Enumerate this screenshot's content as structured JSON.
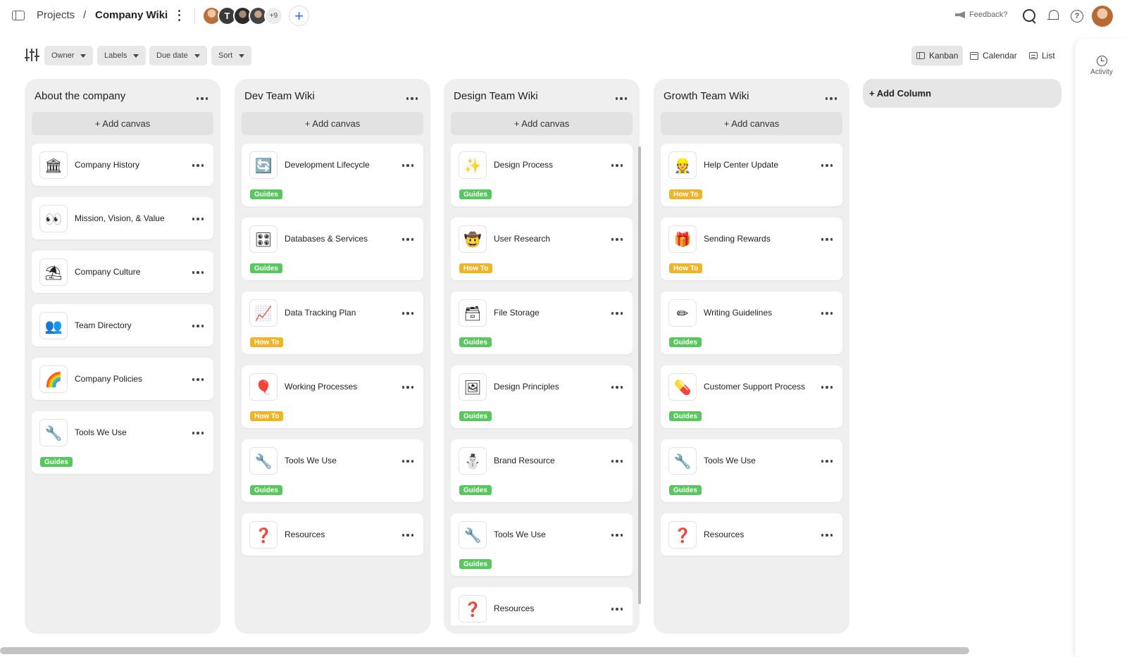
{
  "header": {
    "breadcrumb_root": "Projects",
    "breadcrumb_sep": "/",
    "title": "Company Wiki",
    "avatars": [
      {
        "name": "avatar-1",
        "initial": ""
      },
      {
        "name": "avatar-2",
        "initial": "T"
      },
      {
        "name": "avatar-3",
        "initial": ""
      },
      {
        "name": "avatar-4",
        "initial": ""
      }
    ],
    "more_members": "+9",
    "feedback": "Feedback?"
  },
  "toolbar": {
    "filters": [
      "Owner",
      "Labels",
      "Due date",
      "Sort"
    ],
    "views": {
      "kanban": "Kanban",
      "calendar": "Calendar",
      "list": "List"
    },
    "active_view": "Kanban"
  },
  "activity": {
    "label": "Activity"
  },
  "board": {
    "add_canvas_label": "+ Add canvas",
    "add_column_label": "+ Add Column",
    "columns": [
      {
        "title": "About the company",
        "cards": [
          {
            "icon": "🏛",
            "title": "Company History",
            "tag": ""
          },
          {
            "icon": "👀",
            "title": "Mission, Vision, & Value",
            "tag": ""
          },
          {
            "icon": "⛱",
            "title": "Company Culture",
            "tag": ""
          },
          {
            "icon": "👥",
            "title": "Team Directory",
            "tag": ""
          },
          {
            "icon": "🌈",
            "title": "Company Policies",
            "tag": ""
          },
          {
            "icon": "🔧",
            "title": "Tools We Use",
            "tag": "Guides"
          }
        ]
      },
      {
        "title": "Dev Team Wiki",
        "cards": [
          {
            "icon": "🔄",
            "title": "Development Lifecycle",
            "tag": "Guides"
          },
          {
            "icon": "🎛",
            "title": "Databases & Services",
            "tag": "Guides"
          },
          {
            "icon": "📈",
            "title": "Data Tracking Plan",
            "tag": "How To"
          },
          {
            "icon": "🎈",
            "title": "Working Processes",
            "tag": "How To"
          },
          {
            "icon": "🔧",
            "title": "Tools We Use",
            "tag": "Guides"
          },
          {
            "icon": "❓",
            "title": "Resources",
            "tag": ""
          }
        ]
      },
      {
        "title": "Design Team Wiki",
        "cards": [
          {
            "icon": "✨",
            "title": "Design Process",
            "tag": "Guides"
          },
          {
            "icon": "🤠",
            "title": "User Research",
            "tag": "How To"
          },
          {
            "icon": "🗃",
            "title": "File Storage",
            "tag": "Guides"
          },
          {
            "icon": "🖼",
            "title": "Design Principles",
            "tag": "Guides"
          },
          {
            "icon": "⛄",
            "title": "Brand Resource",
            "tag": "Guides"
          },
          {
            "icon": "🔧",
            "title": "Tools We Use",
            "tag": "Guides"
          },
          {
            "icon": "❓",
            "title": "Resources",
            "tag": ""
          }
        ]
      },
      {
        "title": "Growth Team Wiki",
        "cards": [
          {
            "icon": "👷",
            "title": "Help Center Update",
            "tag": "How To"
          },
          {
            "icon": "🎁",
            "title": "Sending Rewards",
            "tag": "How To"
          },
          {
            "icon": "✏",
            "title": "Writing Guidelines",
            "tag": "Guides"
          },
          {
            "icon": "💊",
            "title": "Customer Support Process",
            "tag": "Guides"
          },
          {
            "icon": "🔧",
            "title": "Tools We Use",
            "tag": "Guides"
          },
          {
            "icon": "❓",
            "title": "Resources",
            "tag": ""
          }
        ]
      }
    ]
  },
  "colors": {
    "guides": "#58c75e",
    "how_to": "#f0b429",
    "accent": "#2f6ee8"
  }
}
